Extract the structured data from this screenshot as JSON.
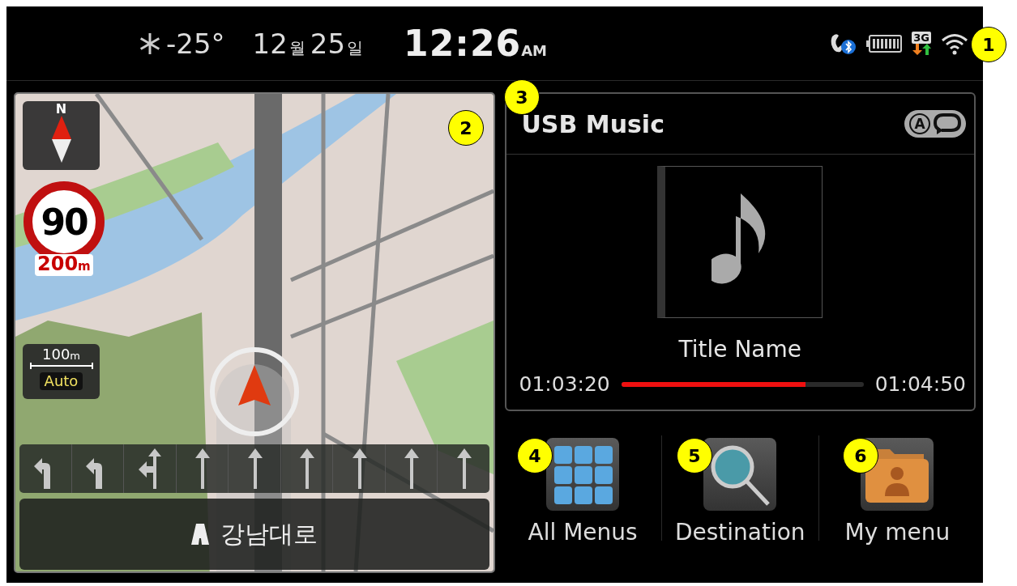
{
  "status_bar": {
    "temperature": "-25°",
    "month": "12",
    "month_unit": "월",
    "day": "25",
    "day_unit": "일",
    "time": "12:26",
    "meridiem": "AM",
    "network": "3G"
  },
  "navigation": {
    "compass_label": "N",
    "speed_limit": "90",
    "distance": "200",
    "distance_unit": "m",
    "scale": "100",
    "scale_unit": "m",
    "scale_mode": "Auto",
    "lanes": [
      {
        "kind": "left"
      },
      {
        "kind": "left"
      },
      {
        "kind": "left-straight"
      },
      {
        "kind": "straight"
      },
      {
        "kind": "straight"
      },
      {
        "kind": "straight"
      },
      {
        "kind": "straight"
      },
      {
        "kind": "straight"
      },
      {
        "kind": "straight"
      }
    ],
    "road_name": "강남대로"
  },
  "music": {
    "source": "USB Music",
    "repeat_mode": "A",
    "title": "Title Name",
    "elapsed": "01:03:20",
    "total": "01:04:50",
    "level": 0.76
  },
  "menu": [
    {
      "label": "All Menus",
      "kind": "grid"
    },
    {
      "label": "Destination",
      "kind": "search"
    },
    {
      "label": "My menu",
      "kind": "folder"
    }
  ],
  "callouts": [
    {
      "number": "1"
    },
    {
      "number": "2"
    },
    {
      "number": "3"
    },
    {
      "number": "4"
    },
    {
      "number": "5"
    },
    {
      "number": "6"
    }
  ]
}
